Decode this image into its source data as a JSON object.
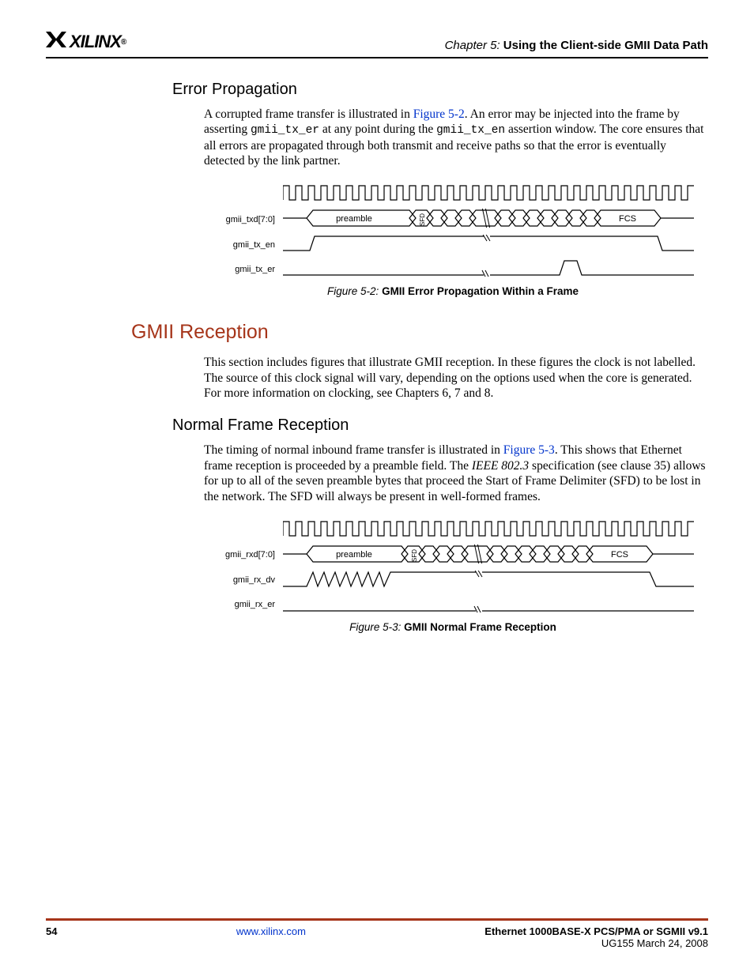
{
  "header": {
    "logo_text": "XILINX",
    "chapter_label": "Chapter 5:",
    "chapter_title": "Using the Client-side GMII Data Path"
  },
  "section_error": {
    "heading": "Error Propagation",
    "p1_a": "A corrupted frame transfer is illustrated in ",
    "p1_link": "Figure 5-2",
    "p1_b": ". An error may be injected into the frame by asserting ",
    "p1_code1": "gmii_tx_er",
    "p1_c": " at any point during the ",
    "p1_code2": "gmii_tx_en",
    "p1_d": " assertion window. The core ensures that all errors are propagated through both transmit and receive paths so that the error is eventually detected by the link partner."
  },
  "figure52": {
    "signals": {
      "txd": "gmii_txd[7:0]",
      "txen": "gmii_tx_en",
      "txer": "gmii_tx_er"
    },
    "bus_labels": {
      "preamble": "preamble",
      "sfd": "SFD",
      "fcs": "FCS"
    },
    "caption_num": "Figure 5-2:",
    "caption_title": "GMII Error Propagation Within a Frame"
  },
  "section_reception": {
    "heading": "GMII Reception",
    "p1": "This section includes figures that illustrate GMII reception. In these figures the clock is not labelled. The source of this clock signal will vary, depending on the options used when the core is generated. For more information on clocking, see Chapters 6, 7 and 8."
  },
  "section_normal": {
    "heading": "Normal Frame Reception",
    "p1_a": "The timing of normal inbound frame transfer is illustrated in ",
    "p1_link": "Figure 5-3",
    "p1_b": ". This shows that Ethernet frame reception is proceeded by a preamble field. The ",
    "p1_spec": "IEEE 802.3",
    "p1_c": " specification (see clause 35) allows for up to all of the seven preamble bytes that proceed the Start of Frame Delimiter (SFD) to be lost in the network. The SFD will always be present in well-formed frames."
  },
  "figure53": {
    "signals": {
      "rxd": "gmii_rxd[7:0]",
      "rxdv": "gmii_rx_dv",
      "rxer": "gmii_rx_er"
    },
    "bus_labels": {
      "preamble": "preamble",
      "sfd": "SFD",
      "fcs": "FCS"
    },
    "caption_num": "Figure 5-3:",
    "caption_title": "GMII Normal Frame Reception"
  },
  "footer": {
    "page": "54",
    "url": "www.xilinx.com",
    "doc_title": "Ethernet 1000BASE-X PCS/PMA or SGMII v9.1",
    "doc_sub": "UG155 March 24, 2008"
  }
}
